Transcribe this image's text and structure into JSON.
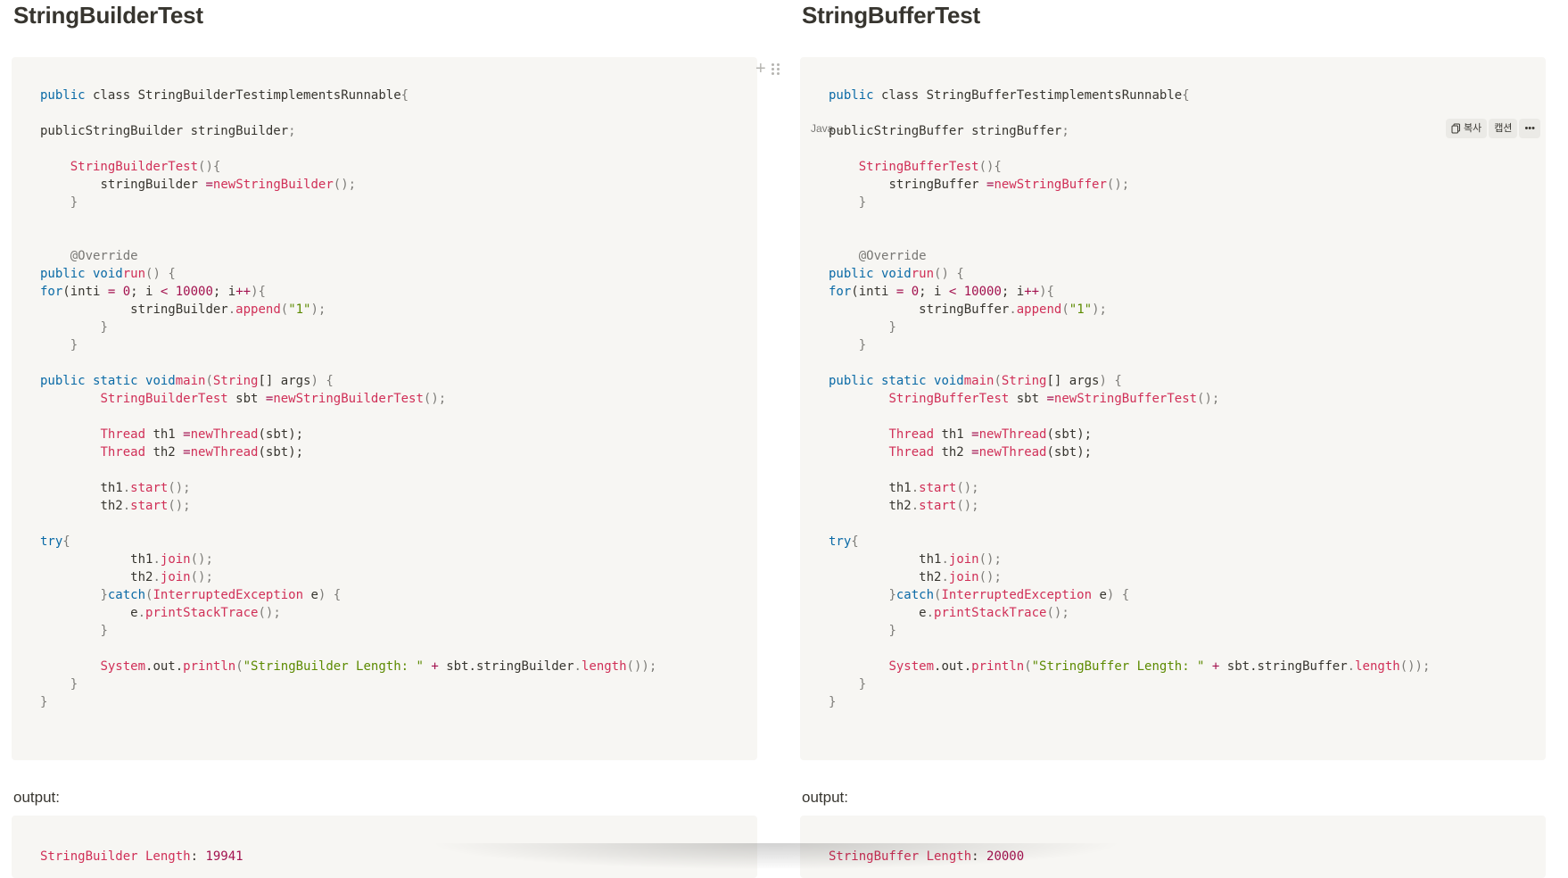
{
  "left": {
    "heading": "StringBuilderTest",
    "output_label": "output:",
    "output_key": "StringBuilder Length",
    "output_sep": ": ",
    "output_value": "19941",
    "code": {
      "l1": [
        "public",
        " class",
        "StringBuilderTest",
        "implements",
        "Runnable",
        "{"
      ],
      "l2": [
        "public",
        "StringBuilder",
        " stringBuilder",
        ";"
      ],
      "l3": [
        "StringBuilderTest",
        "(){"
      ],
      "l4": [
        "stringBuilder ",
        "=",
        "new",
        "StringBuilder",
        "();"
      ],
      "l5": "}",
      "l6": "@Override",
      "l7": [
        "public",
        " void",
        "run",
        "() {"
      ],
      "l8": [
        "for",
        "(int",
        "i ",
        "= ",
        "0",
        "; i ",
        "< ",
        "10000",
        "; i",
        "++",
        "){"
      ],
      "l9": [
        "stringBuilder",
        ".",
        "append",
        "(",
        "\"1\"",
        ");"
      ],
      "l10": "}",
      "l11": "}",
      "l12": [
        "public",
        " static",
        " void",
        "main",
        "(",
        "String",
        "[] args",
        ") {"
      ],
      "l13": [
        "StringBuilderTest",
        " sbt ",
        "=",
        "new",
        "StringBuilderTest",
        "();"
      ],
      "l14": [
        "Thread",
        " th1 ",
        "=",
        "new",
        "Thread",
        "(sbt);"
      ],
      "l15": [
        "Thread",
        " th2 ",
        "=",
        "new",
        "Thread",
        "(sbt);"
      ],
      "l16": [
        "th1",
        ".",
        "start",
        "();"
      ],
      "l17": [
        "th2",
        ".",
        "start",
        "();"
      ],
      "l18": [
        "try",
        "{"
      ],
      "l19": [
        "th1",
        ".",
        "join",
        "();"
      ],
      "l20": [
        "th2",
        ".",
        "join",
        "();"
      ],
      "l21": [
        "}",
        "catch",
        "(",
        "InterruptedException",
        " e",
        ") {"
      ],
      "l22": [
        "e",
        ".",
        "printStackTrace",
        "();"
      ],
      "l23": "}",
      "l24": [
        "System",
        ".out.",
        "println",
        "(",
        "\"StringBuilder Length: \"",
        " + ",
        "sbt",
        ".stringBuilder",
        ".",
        "length",
        "());"
      ],
      "l25": "}",
      "l26": "}"
    }
  },
  "right": {
    "heading": "StringBufferTest",
    "output_label": "output:",
    "output_key": "StringBuffer Length",
    "output_sep": ": ",
    "output_value": "20000",
    "language": "Java",
    "toolbar": {
      "copy": "복사",
      "caption": "캡션",
      "more": "•••"
    },
    "code": {
      "l1": [
        "public",
        " class",
        "StringBufferTest",
        "implements",
        "Runnable",
        "{"
      ],
      "l2": [
        "public",
        "StringBuffer",
        " stringBuffer",
        ";"
      ],
      "l3": [
        "StringBufferTest",
        "(){"
      ],
      "l4": [
        "stringBuffer ",
        "=",
        "new",
        "StringBuffer",
        "();"
      ],
      "l5": "}",
      "l6": "@Override",
      "l7": [
        "public",
        " void",
        "run",
        "() {"
      ],
      "l8": [
        "for",
        "(int",
        "i ",
        "= ",
        "0",
        "; i ",
        "< ",
        "10000",
        "; i",
        "++",
        "){"
      ],
      "l9": [
        "stringBuffer",
        ".",
        "append",
        "(",
        "\"1\"",
        ");"
      ],
      "l10": "}",
      "l11": "}",
      "l12": [
        "public",
        " static",
        " void",
        "main",
        "(",
        "String",
        "[] args",
        ") {"
      ],
      "l13": [
        "StringBufferTest",
        " sbt ",
        "=",
        "new",
        "StringBufferTest",
        "();"
      ],
      "l14": [
        "Thread",
        " th1 ",
        "=",
        "new",
        "Thread",
        "(sbt);"
      ],
      "l15": [
        "Thread",
        " th2 ",
        "=",
        "new",
        "Thread",
        "(sbt);"
      ],
      "l16": [
        "th1",
        ".",
        "start",
        "();"
      ],
      "l17": [
        "th2",
        ".",
        "start",
        "();"
      ],
      "l18": [
        "try",
        "{"
      ],
      "l19": [
        "th1",
        ".",
        "join",
        "();"
      ],
      "l20": [
        "th2",
        ".",
        "join",
        "();"
      ],
      "l21": [
        "}",
        "catch",
        "(",
        "InterruptedException",
        " e",
        ") {"
      ],
      "l22": [
        "e",
        ".",
        "printStackTrace",
        "();"
      ],
      "l23": "}",
      "l24": [
        "System",
        ".out.",
        "println",
        "(",
        "\"StringBuffer Length: \"",
        " + ",
        "sbt",
        ".stringBuffer",
        ".",
        "length",
        "());"
      ],
      "l25": "}",
      "l26": "}"
    }
  }
}
